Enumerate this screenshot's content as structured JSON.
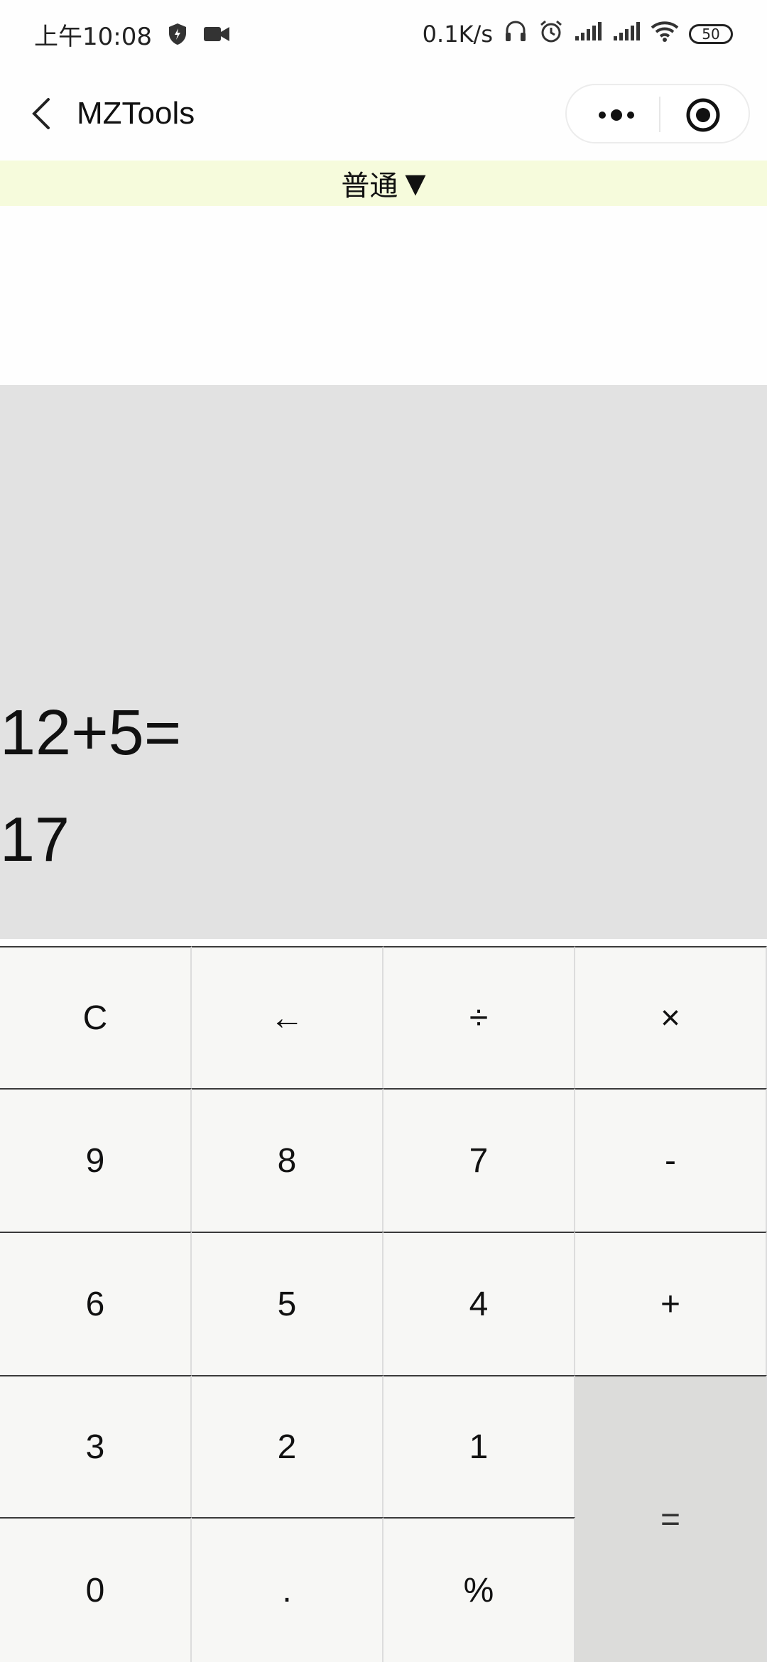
{
  "status_bar": {
    "time": "上午10:08",
    "net_speed": "0.1K/s",
    "battery": "50",
    "icons": [
      "shield-icon",
      "video-icon",
      "headset-icon",
      "alarm-icon",
      "signal-icon",
      "signal-icon",
      "wifi-icon",
      "battery-icon"
    ]
  },
  "nav": {
    "title": "MZTools",
    "back_icon": "back-chevron-icon",
    "more_icon": "more-dots-icon",
    "close_icon": "target-circle-icon"
  },
  "mode": {
    "label": "普通",
    "arrow": "▼"
  },
  "display": {
    "expression": "12+5=",
    "result": "17"
  },
  "keys": {
    "clear": "C",
    "backspace": "←",
    "divide": "÷",
    "multiply": "×",
    "nine": "9",
    "eight": "8",
    "seven": "7",
    "minus": "-",
    "six": "6",
    "five": "5",
    "four": "4",
    "plus": "+",
    "three": "3",
    "two": "2",
    "one": "1",
    "equals": "=",
    "zero": "0",
    "dot": ".",
    "percent": "%"
  },
  "colors": {
    "mode_bar_bg": "#f6fbdc",
    "display_bg": "#e2e2e2",
    "key_bg": "#f7f7f5",
    "equals_bg": "#dcdcda"
  }
}
